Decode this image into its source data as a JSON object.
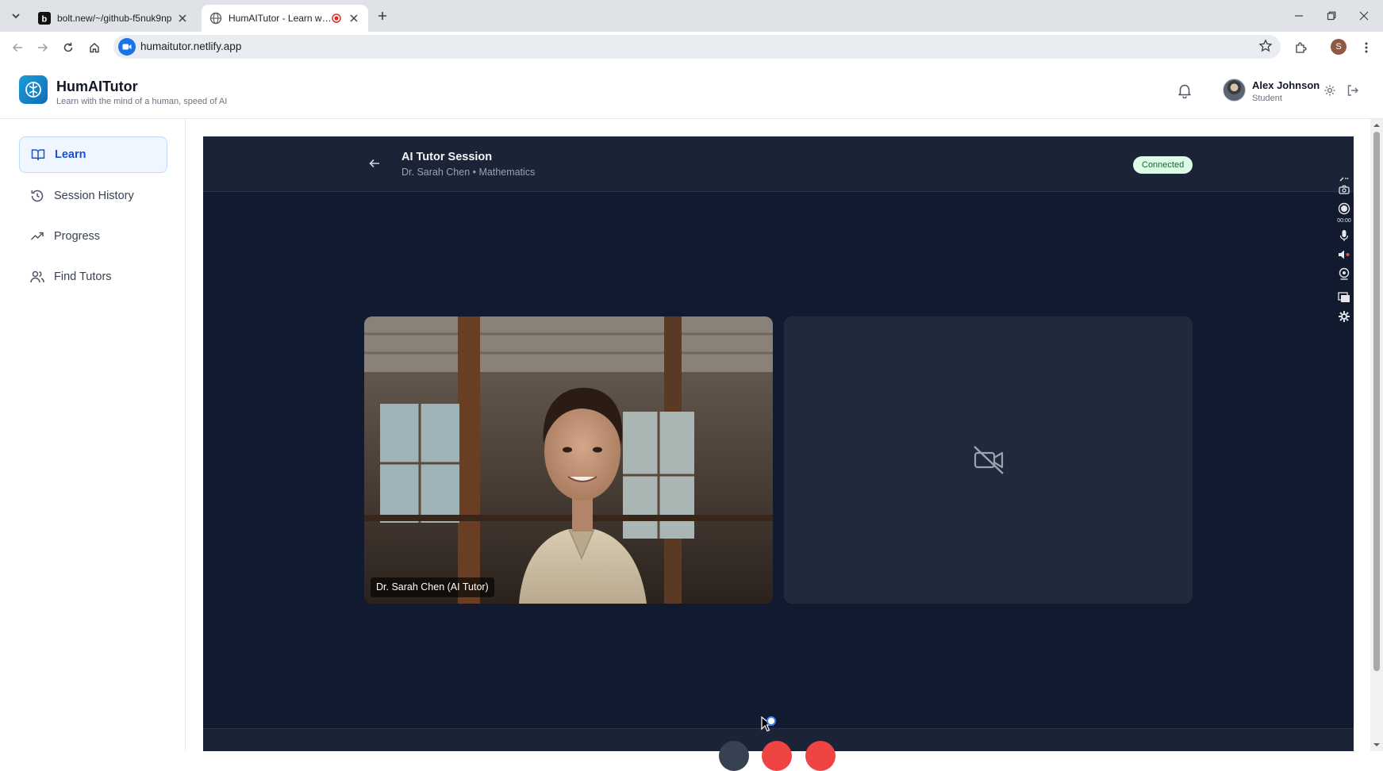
{
  "browser": {
    "tabs": [
      {
        "title": "bolt.new/~/github-f5nuk9np",
        "active": false
      },
      {
        "title": "HumAITutor - Learn with th",
        "active": true
      }
    ],
    "url": "humaitutor.netlify.app",
    "profile_initial": "S"
  },
  "app": {
    "name": "HumAITutor",
    "tagline": "Learn with the mind of a human, speed of AI",
    "user": {
      "name": "Alex Johnson",
      "role": "Student"
    }
  },
  "sidebar": {
    "items": [
      {
        "label": "Learn",
        "icon": "book-open-icon",
        "active": true
      },
      {
        "label": "Session History",
        "icon": "history-icon",
        "active": false
      },
      {
        "label": "Progress",
        "icon": "trending-up-icon",
        "active": false
      },
      {
        "label": "Find Tutors",
        "icon": "users-icon",
        "active": false
      }
    ]
  },
  "session": {
    "title": "AI Tutor Session",
    "subtitle": "Dr. Sarah Chen • Mathematics",
    "status": "Connected",
    "tutor_caption": "Dr. Sarah Chen (AI Tutor)",
    "student_camera": "camera-off-icon"
  },
  "recorder": {
    "timer": "00:00"
  },
  "colors": {
    "accent": "#1d4ed8",
    "session_bg": "#111a2e",
    "header_bg": "#1a2436",
    "status_bg": "#dcfce7",
    "status_text": "#166534",
    "end_call": "#ef4444"
  }
}
